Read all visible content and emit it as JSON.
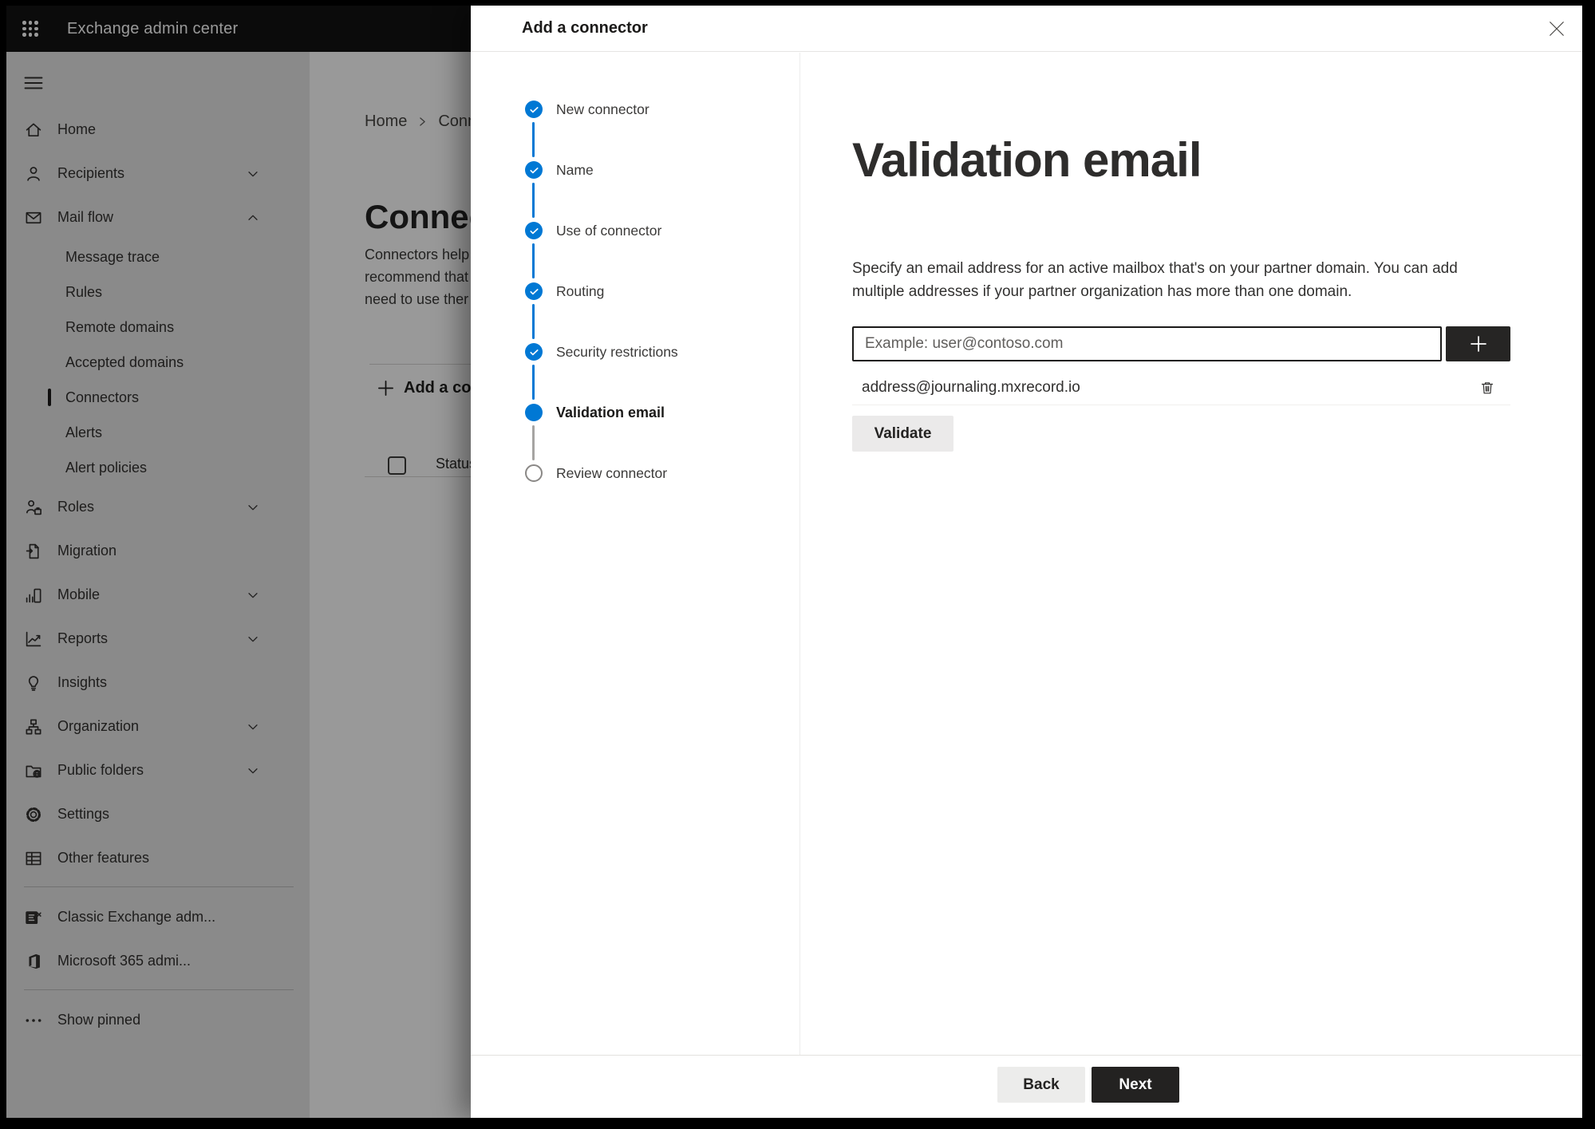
{
  "topbar": {
    "app_title": "Exchange admin center"
  },
  "sidebar": {
    "items": [
      {
        "label": "Home",
        "icon": "home-icon",
        "type": "main"
      },
      {
        "label": "Recipients",
        "icon": "person-icon",
        "type": "main",
        "chevron": "down"
      },
      {
        "label": "Mail flow",
        "icon": "mail-icon",
        "type": "main",
        "chevron": "up"
      },
      {
        "label": "Message trace",
        "type": "sub"
      },
      {
        "label": "Rules",
        "type": "sub"
      },
      {
        "label": "Remote domains",
        "type": "sub"
      },
      {
        "label": "Accepted domains",
        "type": "sub"
      },
      {
        "label": "Connectors",
        "type": "sub",
        "selected": true
      },
      {
        "label": "Alerts",
        "type": "sub"
      },
      {
        "label": "Alert policies",
        "type": "sub"
      },
      {
        "label": "Roles",
        "icon": "roles-icon",
        "type": "main",
        "chevron": "down"
      },
      {
        "label": "Migration",
        "icon": "migration-icon",
        "type": "main"
      },
      {
        "label": "Mobile",
        "icon": "mobile-icon",
        "type": "main",
        "chevron": "down"
      },
      {
        "label": "Reports",
        "icon": "reports-icon",
        "type": "main",
        "chevron": "down"
      },
      {
        "label": "Insights",
        "icon": "insights-icon",
        "type": "main"
      },
      {
        "label": "Organization",
        "icon": "organization-icon",
        "type": "main",
        "chevron": "down"
      },
      {
        "label": "Public folders",
        "icon": "public-folders-icon",
        "type": "main",
        "chevron": "down"
      },
      {
        "label": "Settings",
        "icon": "settings-icon",
        "type": "main"
      },
      {
        "label": "Other features",
        "icon": "other-features-icon",
        "type": "main"
      },
      {
        "type": "divider"
      },
      {
        "label": "Classic Exchange adm...",
        "icon": "classic-exchange-icon",
        "type": "main"
      },
      {
        "label": "Microsoft 365 admi...",
        "icon": "microsoft-365-icon",
        "type": "main"
      },
      {
        "type": "divider"
      },
      {
        "label": "Show pinned",
        "icon": "ellipsis-icon",
        "type": "main"
      }
    ]
  },
  "page_background": {
    "breadcrumb": {
      "items": [
        "Home",
        "Conne"
      ]
    },
    "title": "Connec",
    "intro_lines": [
      "Connectors help",
      "recommend that",
      "need to use ther"
    ],
    "add_connector_label": "Add a conn",
    "table": {
      "first_column_header": "Status"
    }
  },
  "dialog": {
    "title": "Add a connector",
    "steps": [
      {
        "label": "New connector",
        "status": "completed"
      },
      {
        "label": "Name",
        "status": "completed"
      },
      {
        "label": "Use of connector",
        "status": "completed"
      },
      {
        "label": "Routing",
        "status": "completed"
      },
      {
        "label": "Security restrictions",
        "status": "completed"
      },
      {
        "label": "Validation email",
        "status": "current"
      },
      {
        "label": "Review connector",
        "status": "upcoming"
      }
    ],
    "content": {
      "heading": "Validation email",
      "description_lines": [
        "Specify an email address for an active mailbox that's on your partner domain. You can add",
        "multiple addresses if your partner organization has more than one domain."
      ],
      "email_input": {
        "placeholder": "Example: user@contoso.com",
        "value": ""
      },
      "addresses": [
        "address@journaling.mxrecord.io"
      ],
      "validate_label": "Validate"
    },
    "footer": {
      "back_label": "Back",
      "next_label": "Next"
    }
  },
  "colors": {
    "accent_blue": "#0078d4",
    "dark_button": "#262524",
    "topbar_black": "#131313"
  }
}
